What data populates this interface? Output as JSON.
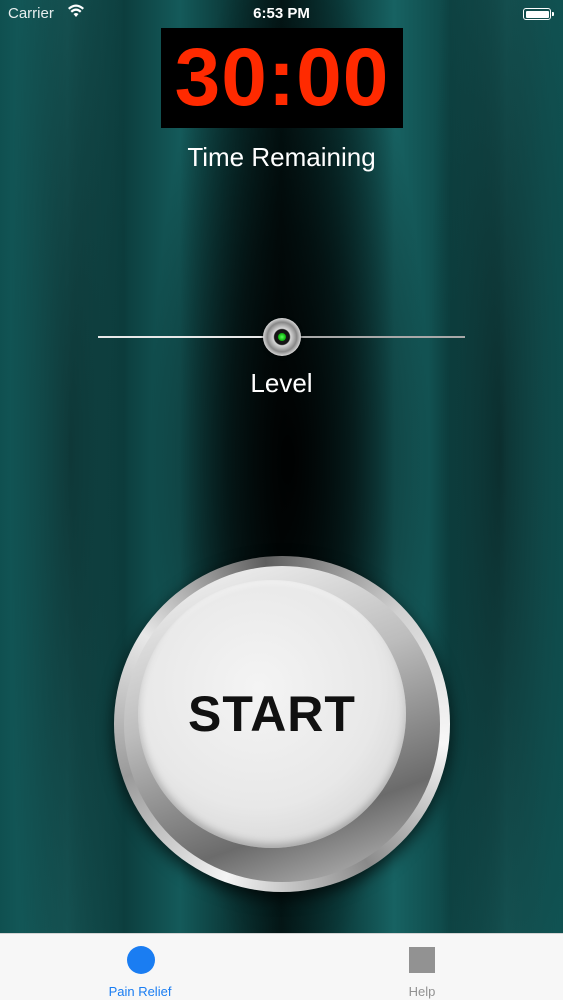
{
  "status_bar": {
    "carrier": "Carrier",
    "time": "6:53 PM",
    "wifi_icon": "wifi-icon",
    "battery_icon": "battery-icon"
  },
  "timer": {
    "value": "30:00",
    "label": "Time Remaining",
    "color": "#ff2a00"
  },
  "level_slider": {
    "label": "Level",
    "value_fraction": 0.5
  },
  "start_button": {
    "label": "START"
  },
  "tab_bar": {
    "accent": "#1a7df2",
    "tabs": [
      {
        "label": "Pain Relief",
        "icon": "circle-icon",
        "selected": true
      },
      {
        "label": "Help",
        "icon": "square-icon",
        "selected": false
      }
    ]
  }
}
